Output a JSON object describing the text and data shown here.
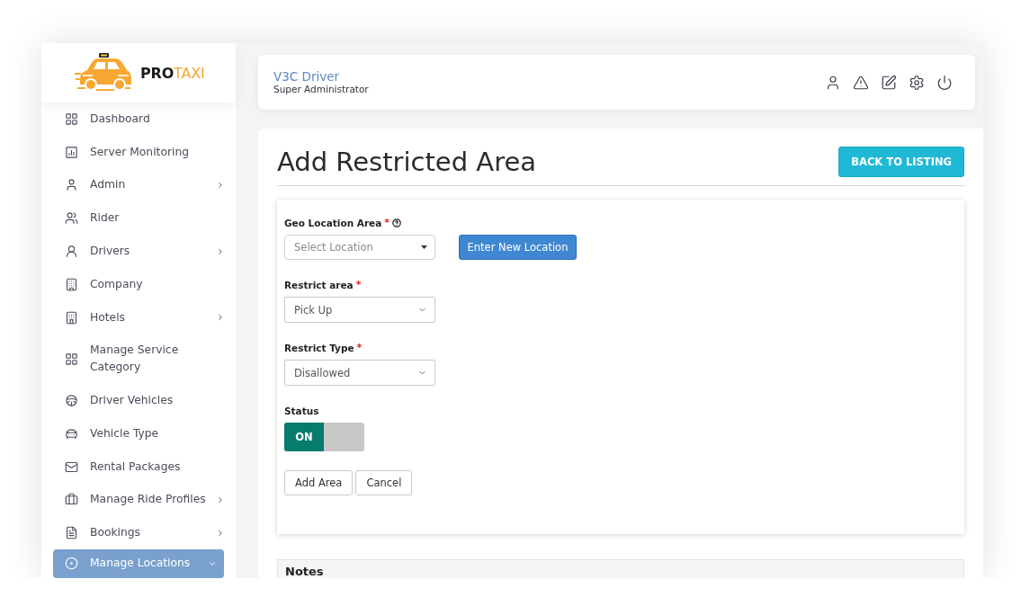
{
  "logo": {
    "prefix": "PRO",
    "suffix": "TAXI"
  },
  "sidebar": {
    "items": [
      {
        "label": "Dashboard",
        "selected": false
      },
      {
        "label": "Server Monitoring",
        "selected": false
      },
      {
        "label": "Admin",
        "selected": false,
        "expanded": false
      },
      {
        "label": "Rider",
        "selected": false
      },
      {
        "label": "Drivers",
        "selected": false,
        "expanded": false
      },
      {
        "label": "Company",
        "selected": false
      },
      {
        "label": "Hotels",
        "selected": false,
        "expanded": false
      },
      {
        "label": "Manage Service Category",
        "selected": false
      },
      {
        "label": "Driver Vehicles",
        "selected": false
      },
      {
        "label": "Vehicle Type",
        "selected": false
      },
      {
        "label": "Rental Packages",
        "selected": false
      },
      {
        "label": "Manage Ride Profiles",
        "selected": false,
        "expanded": false
      },
      {
        "label": "Bookings",
        "selected": false,
        "expanded": false
      },
      {
        "label": "Manage Locations",
        "selected": true,
        "expanded": true
      }
    ]
  },
  "header": {
    "user_name": "V3C Driver",
    "role": "Super Administrator"
  },
  "page": {
    "title": "Add Restricted Area",
    "back_button": "BACK TO LISTING"
  },
  "form": {
    "fields": [
      {
        "kind": "combo",
        "label": "Geo Location Area",
        "mark": "*",
        "help": true,
        "placeholder": "Select Location",
        "action": "Enter New Location"
      },
      {
        "kind": "select",
        "label": "Restrict area",
        "mark": "*",
        "value": "Pick Up"
      },
      {
        "kind": "select",
        "label": "Restrict Type",
        "mark": "*",
        "value": "Disallowed"
      },
      {
        "kind": "toggle",
        "label": "Status",
        "on": true,
        "on_text": "ON"
      }
    ],
    "buttons": [
      "Add Area",
      "Cancel"
    ]
  },
  "notes": {
    "title": "Notes"
  }
}
